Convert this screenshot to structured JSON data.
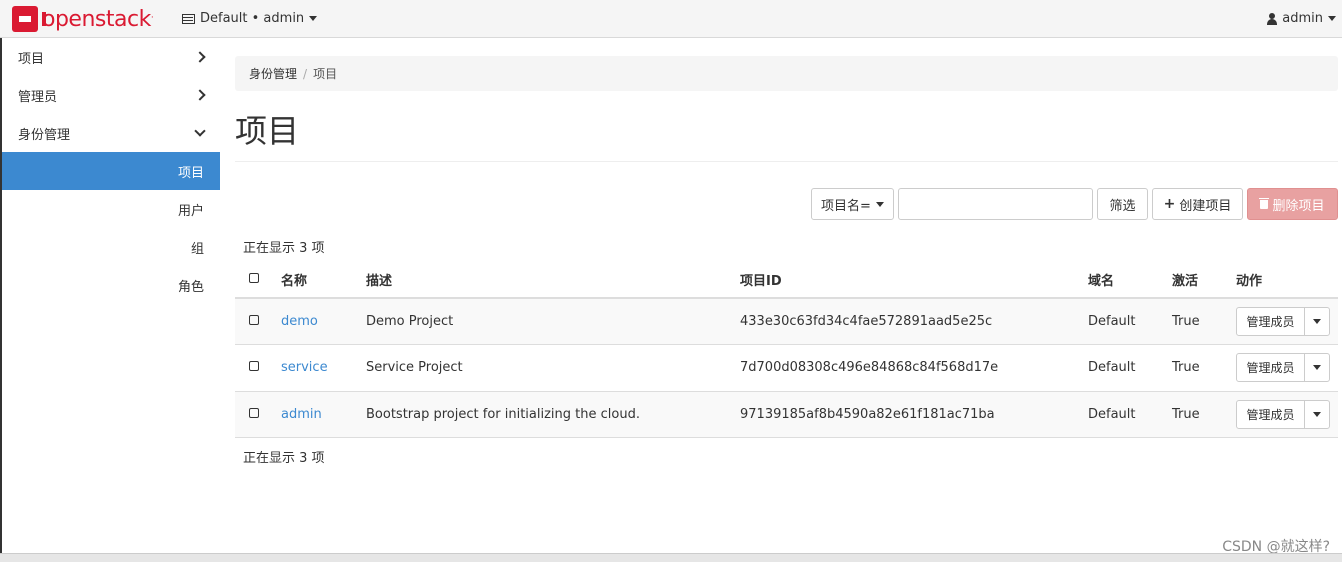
{
  "navbar": {
    "brand": "openstack",
    "brand_mark": ".",
    "context": "Default • admin",
    "user": "admin"
  },
  "sidebar": {
    "panels": [
      {
        "label": "项目",
        "state": "collapsed"
      },
      {
        "label": "管理员",
        "state": "collapsed"
      },
      {
        "label": "身份管理",
        "state": "expanded"
      }
    ],
    "items": [
      {
        "label": "项目",
        "active": true
      },
      {
        "label": "用户"
      },
      {
        "label": "组"
      },
      {
        "label": "角色"
      }
    ]
  },
  "breadcrumb": {
    "parent": "身份管理",
    "separator": "/",
    "current": "项目"
  },
  "page": {
    "title": "项目"
  },
  "toolbar": {
    "filter_field": "项目名=",
    "filter_value": "",
    "filter_button": "筛选",
    "create_button": "创建项目",
    "delete_button": "删除项目"
  },
  "summary": {
    "top": "正在显示 3 项",
    "bottom": "正在显示 3 项"
  },
  "table": {
    "headers": {
      "name": "名称",
      "description": "描述",
      "id": "项目ID",
      "domain": "域名",
      "enabled": "激活",
      "actions": "动作"
    },
    "rows": [
      {
        "name": "demo",
        "description": "Demo Project",
        "id": "433e30c63fd34c4fae572891aad5e25c",
        "domain": "Default",
        "enabled": "True",
        "action": "管理成员"
      },
      {
        "name": "service",
        "description": "Service Project",
        "id": "7d700d08308c496e84868c84f568d17e",
        "domain": "Default",
        "enabled": "True",
        "action": "管理成员"
      },
      {
        "name": "admin",
        "description": "Bootstrap project for initializing the cloud.",
        "id": "97139185af8b4590a82e61f181ac71ba",
        "domain": "Default",
        "enabled": "True",
        "action": "管理成员"
      }
    ]
  },
  "watermark": "CSDN @就这样?",
  "colors": {
    "brand": "#da1a32",
    "active": "#3c89d0",
    "danger": "#e8a1a1",
    "link": "#3c89d0"
  }
}
